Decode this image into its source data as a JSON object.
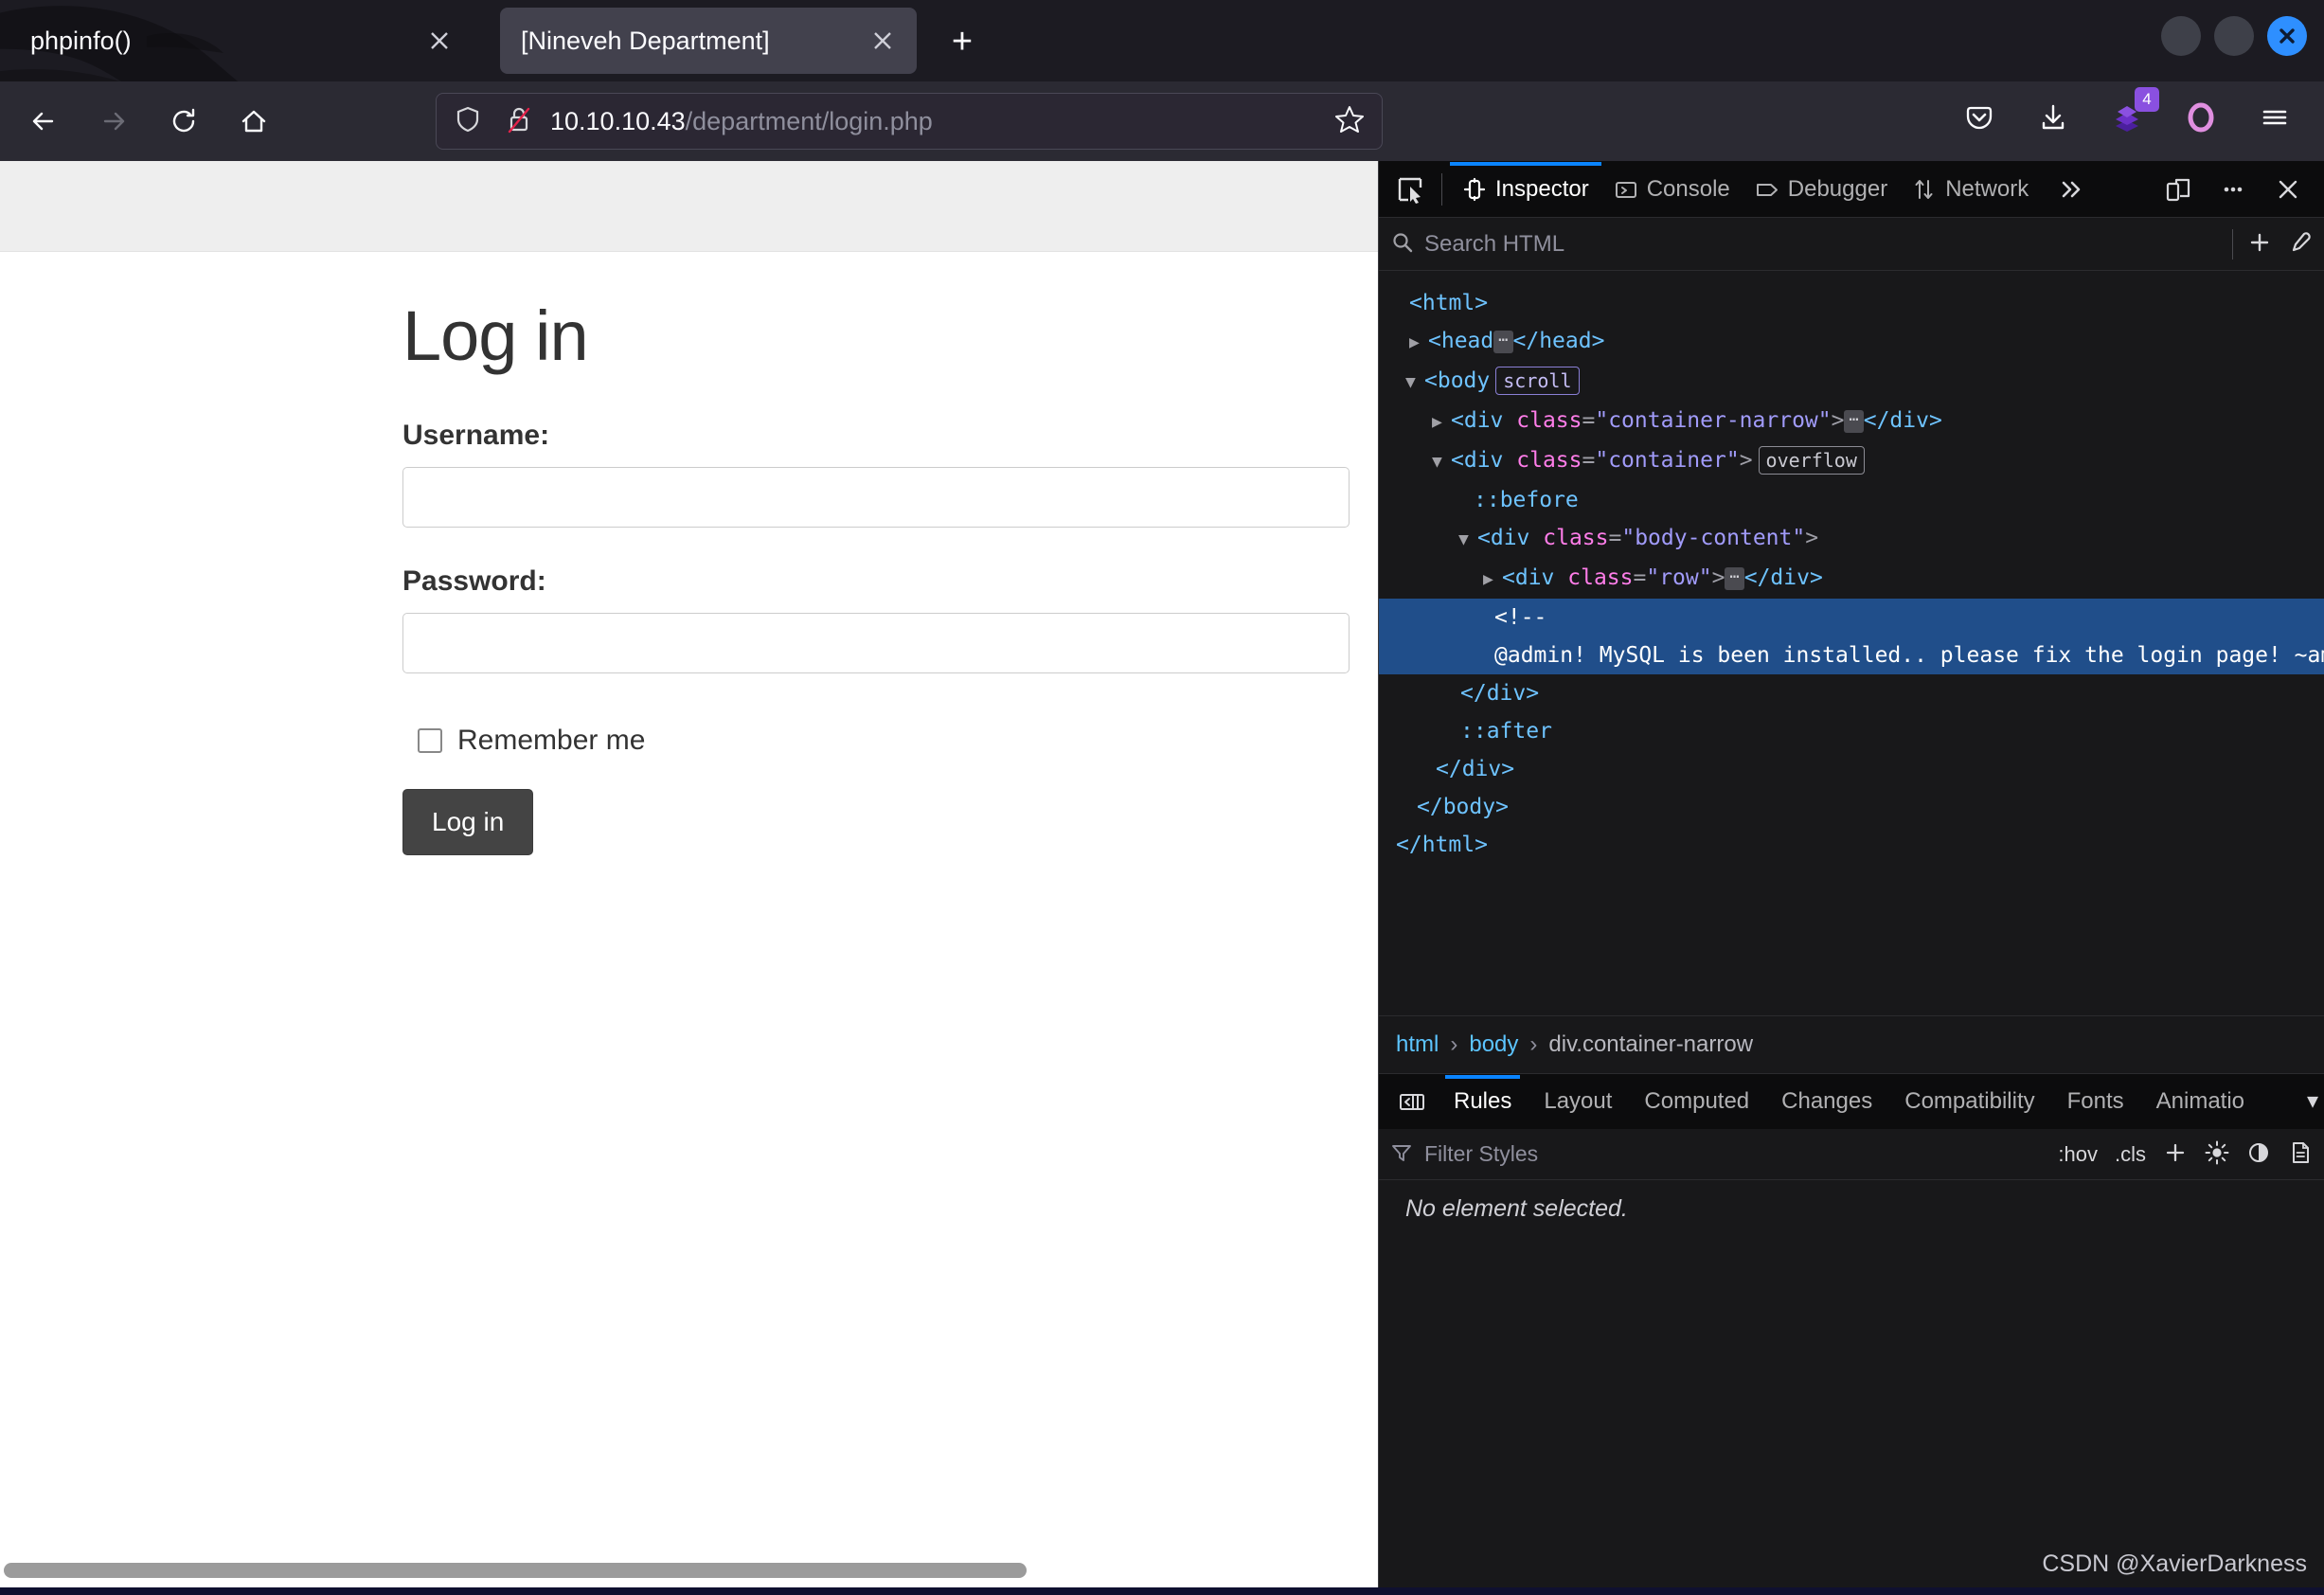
{
  "browser": {
    "tabs": [
      {
        "title": "phpinfo()",
        "active": false,
        "close_icon": "close-icon"
      },
      {
        "title": "[Nineveh Department]",
        "active": true,
        "close_icon": "close-icon"
      }
    ],
    "new_tab_label": "+",
    "window_buttons": [
      "minimize-button",
      "maximize-button",
      "close-button"
    ],
    "window_close_glyph": "✕",
    "nav": {
      "back_icon": "back-arrow-icon",
      "forward_icon": "forward-arrow-icon",
      "reload_icon": "reload-icon",
      "home_icon": "home-icon"
    },
    "url": {
      "host": "10.10.10.43",
      "path": "/department/login.php",
      "shield_icon": "shield-icon",
      "lock_icon": "insecure-lock-icon",
      "bookmark_icon": "star-icon"
    },
    "toolbar_right": {
      "pocket_icon": "pocket-icon",
      "downloads_icon": "download-icon",
      "extension_icon": "extension-icon",
      "extension_badge": "4",
      "account_icon": "account-icon",
      "menu_icon": "hamburger-menu-icon"
    }
  },
  "page": {
    "title": "Log in",
    "username_label": "Username:",
    "username_value": "",
    "password_label": "Password:",
    "password_value": "",
    "remember_label": "Remember me",
    "remember_checked": false,
    "submit_label": "Log in"
  },
  "devtools": {
    "picker_icon": "element-picker-icon",
    "tabs": [
      {
        "label": "Inspector",
        "icon": "inspector-icon",
        "active": true
      },
      {
        "label": "Console",
        "icon": "console-icon",
        "active": false
      },
      {
        "label": "Debugger",
        "icon": "debugger-icon",
        "active": false
      },
      {
        "label": "Network",
        "icon": "network-icon",
        "active": false
      }
    ],
    "overflow_icon": "chevron-double-right-icon",
    "responsive_icon": "responsive-design-mode-icon",
    "meatball_icon": "more-options-icon",
    "close_icon": "close-devtools-icon",
    "search": {
      "placeholder": "Search HTML",
      "search_icon": "search-icon",
      "add_node_icon": "plus-icon",
      "eyedropper_icon": "eyedropper-icon"
    },
    "dom": {
      "lines": [
        {
          "id": "html-open",
          "text": "<html>"
        },
        {
          "id": "head",
          "text": "<head>…</head>"
        },
        {
          "id": "body-open",
          "text": "<body>",
          "badge": "scroll"
        },
        {
          "id": "container-narrow",
          "text": "<div class=\"container-narrow\">…</div>"
        },
        {
          "id": "container",
          "text": "<div class=\"container\">",
          "badge": "overflow"
        },
        {
          "id": "before",
          "text": "::before"
        },
        {
          "id": "body-content",
          "text": "<div class=\"body-content\">"
        },
        {
          "id": "row",
          "text": "<div class=\"row\">…</div>"
        },
        {
          "id": "comment",
          "text": "<!-- @admin! MySQL is been installed.. please fix the login page! ~amrois-->",
          "selected": true
        },
        {
          "id": "close-div-1",
          "text": "</div>"
        },
        {
          "id": "after",
          "text": "::after"
        },
        {
          "id": "close-div-2",
          "text": "</div>"
        },
        {
          "id": "close-body",
          "text": "</body>"
        },
        {
          "id": "close-html",
          "text": "</html>"
        }
      ],
      "comment_open": "<!--",
      "comment_body": "@admin! MySQL is been installed.. please fix the login page! ~amrois-->",
      "scroll_badge": "scroll",
      "overflow_badge": "overflow",
      "before_pseudo": "::before",
      "after_pseudo": "::after"
    },
    "breadcrumb": [
      "html",
      "body",
      "div.container-narrow"
    ],
    "breadcrumb_sep": "›",
    "subtabs": [
      {
        "label": "Rules",
        "active": true
      },
      {
        "label": "Layout",
        "active": false
      },
      {
        "label": "Computed",
        "active": false
      },
      {
        "label": "Changes",
        "active": false
      },
      {
        "label": "Compatibility",
        "active": false
      },
      {
        "label": "Fonts",
        "active": false
      },
      {
        "label": "Animatio",
        "active": false
      }
    ],
    "pane_toggle_icon": "toggle-sidebar-icon",
    "subtabs_more_icon": "chevron-down-icon",
    "filter": {
      "placeholder": "Filter Styles",
      "filter_icon": "funnel-icon",
      "hov": ":hov",
      "cls": ".cls",
      "add_rule_icon": "plus-icon",
      "light_scheme_icon": "sun-icon",
      "dark_scheme_icon": "moon-icon",
      "print_media_icon": "document-icon"
    },
    "empty_message": "No element selected."
  },
  "watermark": "CSDN @XavierDarkness",
  "colors": {
    "accent_blue": "#0a84ff",
    "selection_blue": "#204e8a",
    "chrome_bg": "#2b2a33",
    "tabstrip_bg": "#1c1b22",
    "devtools_bg": "#18181a",
    "page_bg": "#ffffff",
    "button_gray": "#444444",
    "badge_purple": "#8a50e0"
  }
}
